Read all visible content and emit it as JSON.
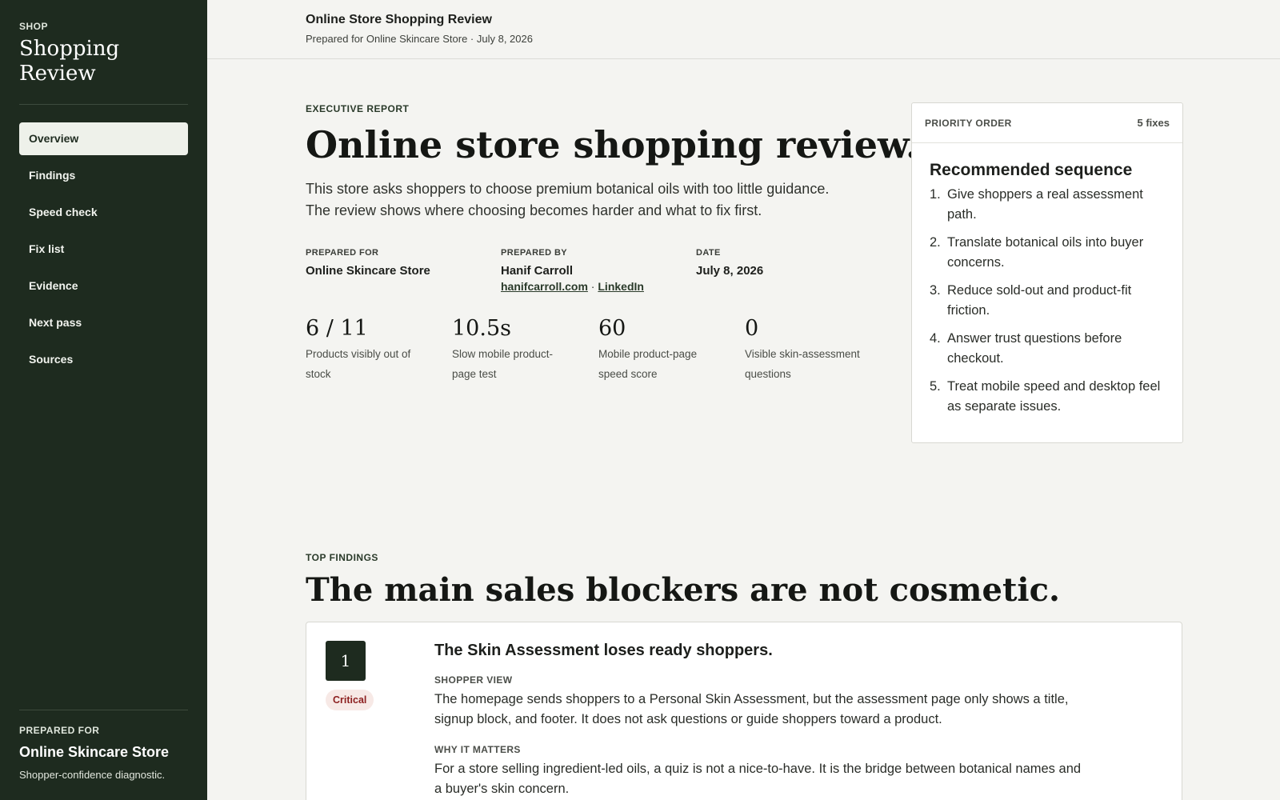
{
  "sidebar": {
    "eyebrow": "SHOP",
    "title": "Shopping Review",
    "nav": [
      {
        "label": "Overview",
        "active": true
      },
      {
        "label": "Findings"
      },
      {
        "label": "Speed check"
      },
      {
        "label": "Fix list"
      },
      {
        "label": "Evidence"
      },
      {
        "label": "Next pass"
      },
      {
        "label": "Sources"
      }
    ],
    "footer": {
      "eyebrow": "PREPARED FOR",
      "name": "Online Skincare Store",
      "description": "Shopper-confidence diagnostic."
    }
  },
  "header": {
    "title": "Online Store Shopping Review",
    "subtitle": "Prepared for Online Skincare Store · July 8, 2026"
  },
  "hero": {
    "eyebrow": "EXECUTIVE REPORT",
    "title": "Online store shopping review.",
    "description": "This store asks shoppers to choose premium botanical oils with too little guidance. The review shows where choosing becomes harder and what to fix first."
  },
  "meta": {
    "prepared_for_label": "PREPARED FOR",
    "prepared_for_value": "Online Skincare Store",
    "prepared_by_label": "PREPARED BY",
    "prepared_by_value": "Hanif Carroll",
    "website_link": "hanifcarroll.com",
    "separator": " · ",
    "linkedin_link": "LinkedIn",
    "date_label": "DATE",
    "date_value": "July 8, 2026"
  },
  "stats": [
    {
      "value": "6 / 11",
      "label": "Products visibly out of stock"
    },
    {
      "value": "10.5s",
      "label": "Slow mobile product-page test"
    },
    {
      "value": "60",
      "label": "Mobile product-page speed score"
    },
    {
      "value": "0",
      "label": "Visible skin-assessment questions"
    }
  ],
  "priority": {
    "label": "PRIORITY ORDER",
    "count": "5 fixes",
    "title": "Recommended sequence",
    "items": [
      {
        "num": "1.",
        "text": "Give shoppers a real assessment path."
      },
      {
        "num": "2.",
        "text": "Translate botanical oils into buyer concerns."
      },
      {
        "num": "3.",
        "text": "Reduce sold-out and product-fit friction."
      },
      {
        "num": "4.",
        "text": "Answer trust questions before checkout."
      },
      {
        "num": "5.",
        "text": "Treat mobile speed and desktop feel as separate issues."
      }
    ]
  },
  "findings": {
    "eyebrow": "TOP FINDINGS",
    "title": "The main sales blockers are not cosmetic.",
    "cards": [
      {
        "number": "1",
        "severity": "Critical",
        "title": "The Skin Assessment loses ready shoppers.",
        "shopper_view_label": "SHOPPER VIEW",
        "shopper_view_text": "The homepage sends shoppers to a Personal Skin Assessment, but the assessment page only shows a title, signup block, and footer. It does not ask questions or guide shoppers toward a product.",
        "why_label": "WHY IT MATTERS",
        "why_text": "For a store selling ingredient-led oils, a quiz is not a nice-to-have. It is the bridge between botanical names and a buyer's skin concern."
      }
    ]
  },
  "colors": {
    "sidebar_bg": "#1e2b1f",
    "page_bg": "#f4f4f1",
    "critical": "#8c1f1f"
  }
}
